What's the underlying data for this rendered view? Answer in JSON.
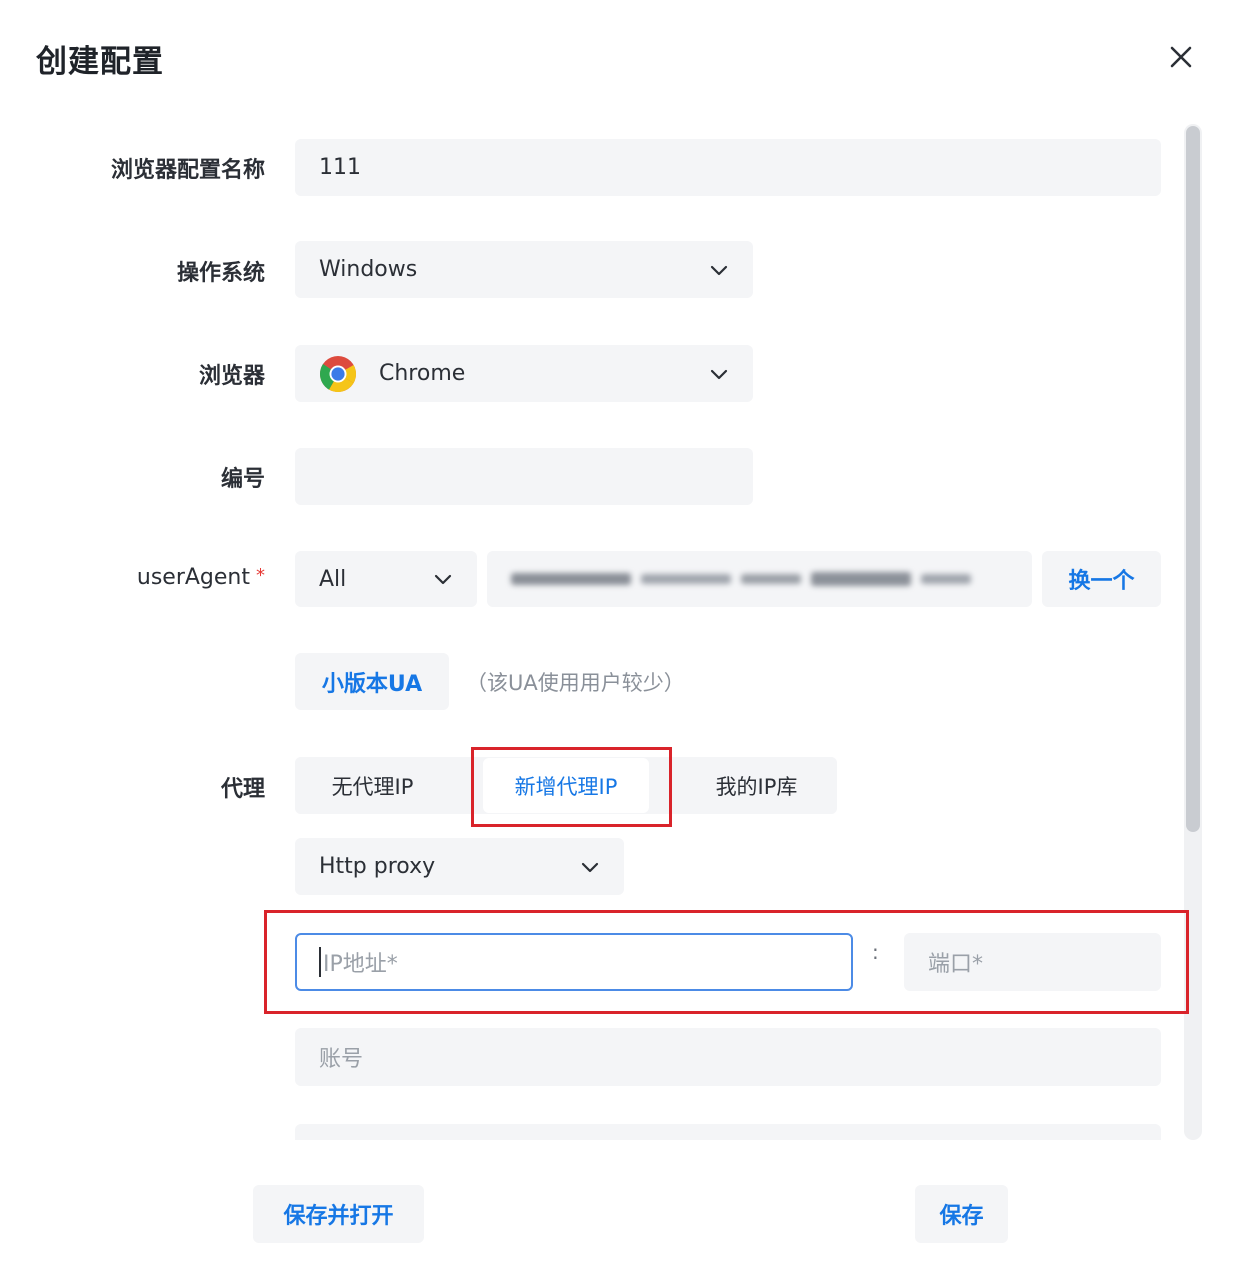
{
  "dialog": {
    "title": "创建配置",
    "close_icon": "close-icon"
  },
  "form": {
    "profile_name": {
      "label": "浏览器配置名称",
      "value": "111"
    },
    "os": {
      "label": "操作系统",
      "value": "Windows"
    },
    "browser": {
      "label": "浏览器",
      "value": "Chrome",
      "icon": "chrome-icon"
    },
    "serial": {
      "label": "编号",
      "value": ""
    },
    "user_agent": {
      "label": "userAgent",
      "required_mark": "*",
      "type_value": "All",
      "switch_button": "换一个",
      "minor_ua_button": "小版本UA",
      "minor_ua_note": "（该UA使用用户较少）"
    },
    "proxy": {
      "label": "代理",
      "tabs": [
        "无代理IP",
        "新增代理IP",
        "我的IP库"
      ],
      "active_tab": "新增代理IP",
      "protocol": "Http proxy",
      "ip_placeholder": "IP地址*",
      "colon": ":",
      "port_placeholder": "端口*",
      "account_placeholder": "账号"
    }
  },
  "footer": {
    "save_open_button": "保存并打开",
    "save_button": "保存"
  },
  "colors": {
    "accent": "#1677e5",
    "highlight_border": "#d9232a",
    "field_bg": "#f4f5f7"
  }
}
